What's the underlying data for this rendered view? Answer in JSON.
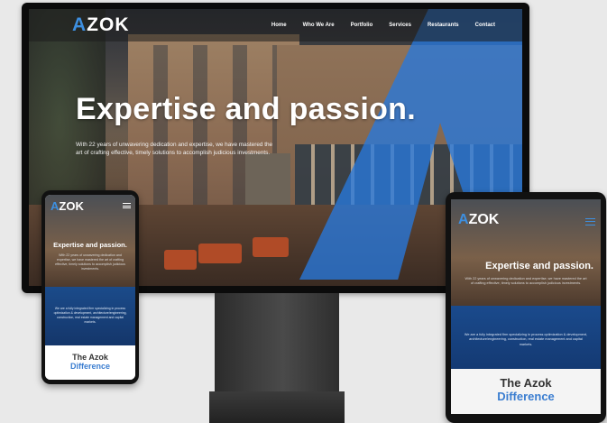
{
  "colors": {
    "brand_blue": "#3d8fe0",
    "dark_blue": "#1a4a8c",
    "background": "#e9e9e9"
  },
  "brand": {
    "logo_prefix": "A",
    "logo_rest": "ZOK"
  },
  "desktop": {
    "nav": [
      "Home",
      "Who We Are",
      "Portfolio",
      "Services",
      "Restaurants",
      "Contact"
    ],
    "hero_title": "Expertise and passion.",
    "hero_text": "With 22 years of unwavering dedication and expertise, we have mastered the art of crafting effective, timely solutions to accomplish judicious investments."
  },
  "phone": {
    "hero_title": "Expertise and passion.",
    "hero_text": "With 22 years of unwavering dedication and expertise, we have mastered the art of crafting effective, timely solutions to accomplish judicious investments.",
    "blue_text": "We are a fully integrated firm specializing in process optimization & development, architecture/engineering, construction, real estate management and capital markets.",
    "diff_line1": "The Azok",
    "diff_line2": "Difference"
  },
  "tablet": {
    "hero_title": "Expertise and passion.",
    "hero_text": "With 22 years of unwavering dedication and expertise, we have mastered the art of crafting effective, timely solutions to accomplish judicious investments.",
    "blue_text": "We are a fully integrated firm specializing in process optimization & development, architecture/engineering, construction, real estate management and capital markets.",
    "diff_line1": "The Azok",
    "diff_line2": "Difference"
  }
}
